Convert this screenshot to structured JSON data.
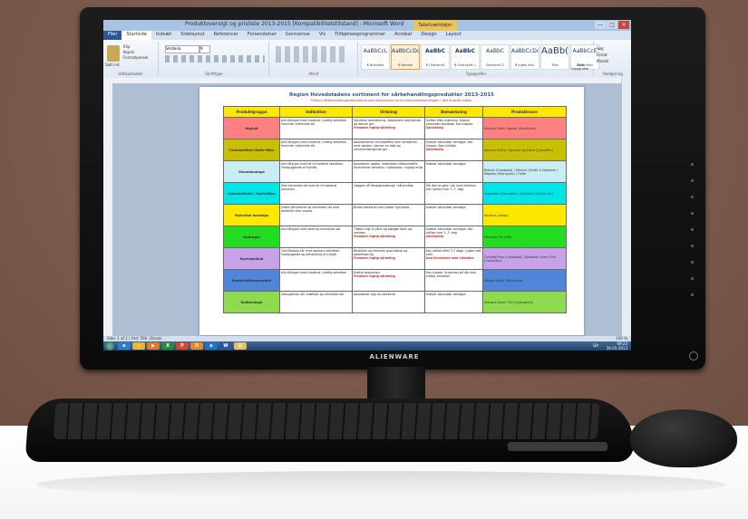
{
  "window": {
    "title": "Produktoversigt og prisliste 2013-2015 [Kompatibilitetstilstand] - Microsoft Word",
    "context_tab": "Tabelværktøjer",
    "controls": [
      "—",
      "□",
      "✕"
    ]
  },
  "ribbon": {
    "tabs": [
      "Filer",
      "Startside",
      "Indsæt",
      "Sidelayout",
      "Referencer",
      "Forsendelser",
      "Gennemse",
      "Vis",
      "Tilføjelsesprogrammer",
      "Acrobat",
      "Design",
      "Layout"
    ],
    "active_tab": "Startside",
    "clipboard": {
      "paste": "Sæt ind",
      "cut": "Klip",
      "copy": "Kopiér",
      "painter": "Formatpensel",
      "label": "Udklipsholder"
    },
    "font": {
      "name": "Verdana",
      "size": "9",
      "label": "Skrifttype"
    },
    "paragraph_label": "Afsnit",
    "styles": [
      {
        "sample": "AaBbCcL",
        "name": "¶ Blokdata"
      },
      {
        "sample": "AaBbCcDd",
        "name": "¶ Normal",
        "selected": true
      },
      {
        "sample": "AaBbC",
        "name": "¶ Overskrift"
      },
      {
        "sample": "AaBbC",
        "name": "¶ Overskrift 1"
      },
      {
        "sample": "AaBbC",
        "name": "Overskrift 2"
      },
      {
        "sample": "AaBbCcDd",
        "name": "¶ Ingen afst."
      },
      {
        "sample": "AaBb(",
        "name": "Titel",
        "big": true
      },
      {
        "sample": "AaBbCcE",
        "name": "Undertitel"
      }
    ],
    "styles_label": "Typografier",
    "change_styles": "Skift typografier",
    "editing": [
      "Søg",
      "Erstat",
      "Markér"
    ],
    "editing_label": "Redigering"
  },
  "document": {
    "title": "Region Hovedstadens sortiment for sårbehandlingsprodukter 2013-2015",
    "subtitle": "Tilskyrs sårbehandlingsprodukterne skal bestemmes ud fra tilskudsbehandlingen i den enkelte region.",
    "table": {
      "headers": [
        "Produktgruppe",
        "Indikation",
        "Virkning",
        "Bemærkning",
        "Produktnavn"
      ],
      "rows": [
        {
          "group": "Alginat",
          "color": "#ff8080",
          "indikation": "Alle sårtyper med moderat / kraftig sekretion herunder inficerede sår",
          "virkning": "Sekretion absorbering. Absorberer udfyldende og danner gel.",
          "virkning_red": "Fremmer fugtig sårheling",
          "bemaerkning": "Skiftes efter mætning. Kræver sekundær bandage. Kan klippes.",
          "bemaerkning_red": "Sølvholdig",
          "produkt": "Kliniske Fiber/ Alginat (Molnlycke)"
        },
        {
          "group": "Cellulosefiber/Gelle-fiber",
          "color": "#c8c000",
          "indikation": "Alle sårtyper med moderat / kraftig sekretion herunder inficerede sår",
          "virkning": "Absorberende cellulosefibre som omdannes med væsken, danner en blød og sammenhængende gel.",
          "bemaerkning": "Kræver sekundær bandage. Kan klippes. Sølv-holdige.",
          "bemaerkning_red": "Sølvholdig",
          "produkt": "Aquacel Extra / Aquacel Ag Extra (ConvaTec)"
        },
        {
          "group": "Skumbandage",
          "color": "#c9ecf5",
          "indikation": "Alle sårtyper med let til moderat sekretion. Forebyggende af tryksår.",
          "virkning": "Absorberer væske. Indeholder silikonehæfte. Kontrollerer sekretion. Opbevares i fugtigt miljø.",
          "bemaerkning": "Kræver sekundær bandage",
          "produkt": "Biatain (Coloplast) / Allevyn (Smith & Nephew) / Mepilex (Molnlycke) / Tielle"
        },
        {
          "group": "Hydrokolloide / Hydrofiber",
          "color": "#00e5e5",
          "indikation": "Ikke inficerede sår med let til moderat sekretion.",
          "virkning": "Lægges på hensigtsmæssigt i sårområde",
          "bemaerkning": "Må ikke bruges i sår med infektion. Kan skiftes hver 3.-7. dag.",
          "produkt": "Granuflex (ConvaTec) / Duoderm (Conva Tec)"
        },
        {
          "group": "Hydrofob bandage",
          "color": "#ffe800",
          "indikation": "Svært sårhelende og inficerede sår med bakterier eller svamp.",
          "virkning": "Binder bakterier som sidder hydrofobt.",
          "bemaerkning": "Kræver sekundær bandage",
          "produkt": "Sorbact (Abigo)"
        },
        {
          "group": "Hydrogel",
          "color": "#22dd22",
          "indikation": "Alle sårtyper med tørre og nekrotiske sår",
          "virkning": "Tilfører fugt til såret og blødgør fibrin og nekrose.",
          "virkning_red": "Fremmer fugtig sårheling",
          "bemaerkning": "Kræver sekundær bandage. Kan skiftes hver 1.-3. dag.",
          "bemaerkning_red": "Sølvholdig",
          "produkt": "Intrasite Gel (S/N)"
        },
        {
          "group": "Hydrokolloid",
          "color": "#c7a2e8",
          "indikation": "Overfladiske sår med sparsom sekretion. Forebyggelse og behandling af tryksår",
          "virkning": "Beskytter og fremmer granulation og epithelisering.",
          "virkning_red": "Fremmer fugtig sårheling",
          "bemaerkning": "Kan skiftes efter 3-7 dage. Lugter ved skift.",
          "bemaerkning_red": "Kan forveksles med infektion",
          "produkt": "Comfeel Plus (Coloplast) / Duoderm Extra Thin (ConvaTec)"
        },
        {
          "group": "Kombinationsprodukt",
          "color": "#4f86d9",
          "indikation": "Alle sårtyper med moderat / kraftig sekretion",
          "virkning": "Kraftig absorption.",
          "virkning_red": "Fremmer fugtig sårheling",
          "bemaerkning": "Kan klippes. Anvendes på sår med kraftig sekretion.",
          "produkt": "Mextra Super (Molnlycke)"
        },
        {
          "group": "Kulbandage",
          "color": "#8fdb4f",
          "indikation": "Ildelugtende sår, kræftsår og inficerede sår",
          "virkning": "Absorberer lugt fra sårsekret",
          "bemaerkning": "Kræver sekundær bandage",
          "produkt": "Actisorb Silver 220 (Systagenix)"
        }
      ]
    }
  },
  "statusbar": {
    "left": "Side: 1 af 2 | Ord: 566 | Dansk",
    "zoom": "100 %"
  },
  "taskbar": {
    "apps": [
      {
        "name": "ie-icon",
        "color": "#2f7bd0",
        "glyph": "e"
      },
      {
        "name": "explorer-icon",
        "color": "#e6b33c",
        "glyph": "▭"
      },
      {
        "name": "media-icon",
        "color": "#e07a2a",
        "glyph": "▶"
      },
      {
        "name": "excel-icon",
        "color": "#2b8a3e",
        "glyph": "X"
      },
      {
        "name": "powerpoint-icon",
        "color": "#d2452e",
        "glyph": "P"
      },
      {
        "name": "outlook-icon",
        "color": "#e8862a",
        "glyph": "O"
      },
      {
        "name": "browser-icon",
        "color": "#1e73c9",
        "glyph": "e"
      },
      {
        "name": "word-icon",
        "color": "#2b579a",
        "glyph": "W"
      },
      {
        "name": "folder-icon",
        "color": "#e3c160",
        "glyph": "▤"
      }
    ],
    "language": "DA",
    "time": "09:23",
    "date": "26-05-2013"
  },
  "hardware": {
    "brand": "ALIENWARE"
  }
}
